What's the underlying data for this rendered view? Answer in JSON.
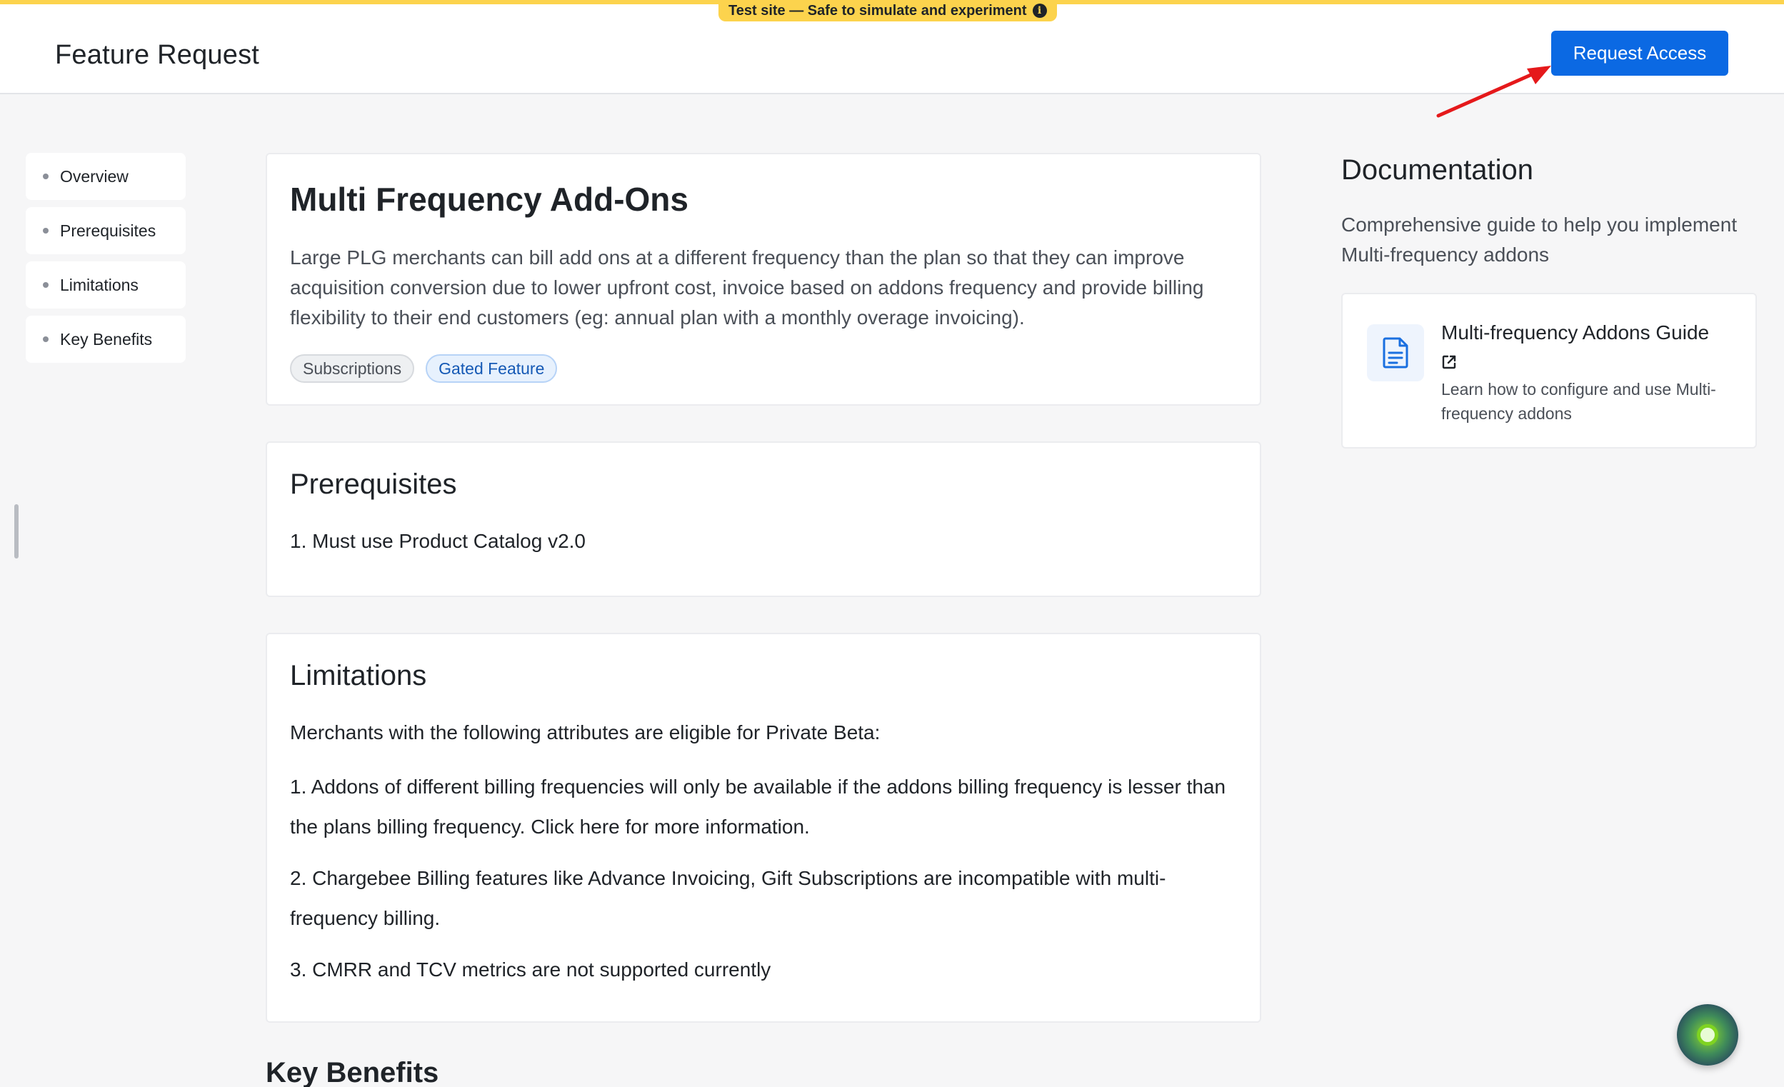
{
  "banner": {
    "text": "Test site — Safe to simulate and experiment",
    "icon": "info-icon"
  },
  "header": {
    "title": "Feature Request",
    "request_button": "Request Access"
  },
  "sidebar": {
    "items": [
      {
        "label": "Overview"
      },
      {
        "label": "Prerequisites"
      },
      {
        "label": "Limitations"
      },
      {
        "label": "Key Benefits"
      }
    ]
  },
  "overview": {
    "title": "Multi Frequency Add-Ons",
    "description": "Large PLG merchants can bill add ons at a different frequency than the plan so that they can improve acquisition conversion due to lower upfront cost, invoice based on addons frequency and provide billing flexibility to their end customers (eg: annual plan with a monthly overage invoicing).",
    "tags": [
      "Subscriptions",
      "Gated Feature"
    ]
  },
  "prerequisites": {
    "title": "Prerequisites",
    "items": [
      "1. Must use Product Catalog v2.0"
    ]
  },
  "limitations": {
    "title": "Limitations",
    "intro": "Merchants with the following attributes are eligible for Private Beta:",
    "items": [
      "1. Addons of different billing frequencies will only be available if the addons billing frequency is lesser than the plans billing frequency. Click here for more information.",
      "2. Chargebee Billing features like Advance Invoicing, Gift Subscriptions are incompatible with multi-frequency billing.",
      "3. CMRR and TCV metrics are not supported currently"
    ]
  },
  "key_benefits": {
    "title": "Key Benefits"
  },
  "documentation": {
    "title": "Documentation",
    "description": "Comprehensive guide to help you implement Multi-frequency addons",
    "guide": {
      "title": "Multi-frequency Addons Guide",
      "description": "Learn how to configure and use Multi-frequency addons",
      "icon": "document-icon",
      "link_icon": "external-link-icon"
    }
  },
  "colors": {
    "accent": "#0b69e3",
    "banner": "#fcd34d",
    "annotation_arrow": "#e5191b"
  }
}
